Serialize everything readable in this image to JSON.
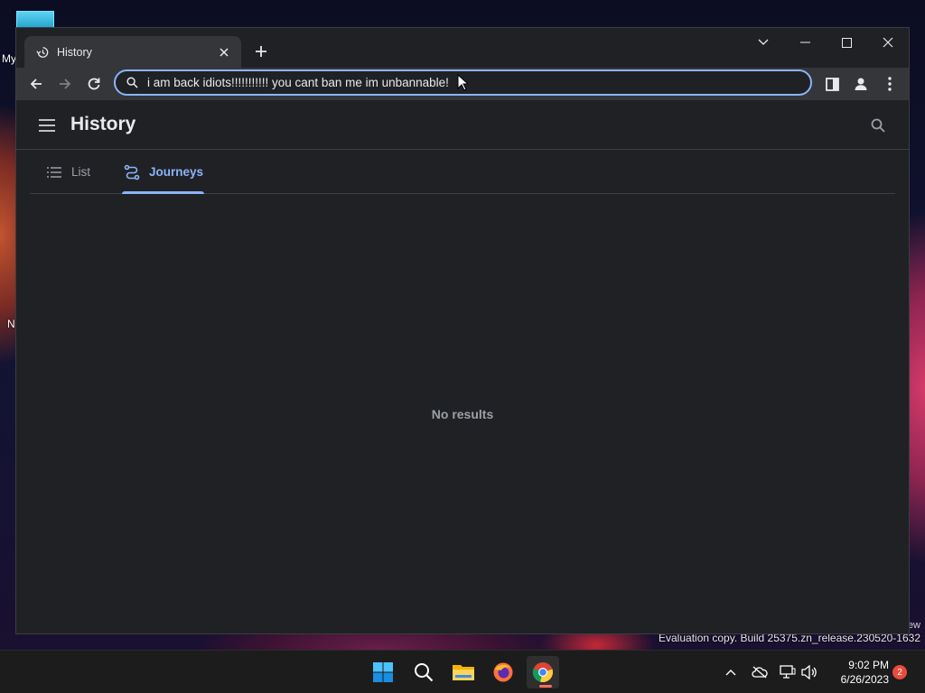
{
  "desktop": {
    "labels": [
      "My",
      "N"
    ],
    "watermark_partial": "ew",
    "watermark": "Evaluation copy. Build 25375.zn_release.230520-1632"
  },
  "browser": {
    "tab": {
      "title": "History",
      "icon": "history-icon"
    },
    "omnibox": {
      "value": "i am back idiots!!!!!!!!!!! you cant ban me im unbannable!"
    }
  },
  "history_page": {
    "title": "History",
    "tabs": [
      {
        "label": "List",
        "icon": "list-icon",
        "selected": false
      },
      {
        "label": "Journeys",
        "icon": "journeys-icon",
        "selected": true
      }
    ],
    "empty_message": "No results"
  },
  "taskbar": {
    "apps": [
      "windows-start-icon",
      "search-icon",
      "file-explorer-icon",
      "firefox-icon",
      "chrome-icon"
    ],
    "clock_time": "9:02 PM",
    "clock_date": "6/26/2023",
    "notification_count": "2"
  },
  "colors": {
    "accent": "#8ab4f8",
    "window_bg": "#202124",
    "toolbar_bg": "#35363a"
  }
}
